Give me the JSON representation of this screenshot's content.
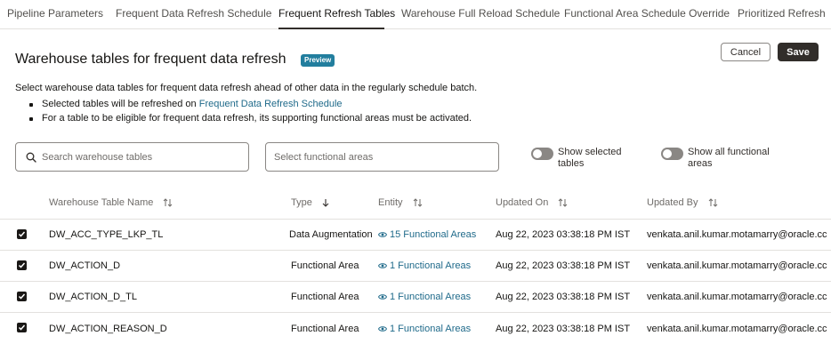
{
  "tabs": [
    {
      "label": "Pipeline Parameters"
    },
    {
      "label": "Frequent Data Refresh Schedule"
    },
    {
      "label": "Frequent Refresh Tables"
    },
    {
      "label": "Warehouse Full Reload Schedule"
    },
    {
      "label": "Functional Area Schedule Override"
    },
    {
      "label": "Prioritized Refresh"
    }
  ],
  "header": {
    "title": "Warehouse tables for frequent data refresh",
    "badge": "Preview",
    "cancel_label": "Cancel",
    "save_label": "Save"
  },
  "description": {
    "text": "Select warehouse data tables for frequent data refresh ahead of other data in the regularly schedule batch.",
    "bullet1_prefix": "Selected tables will be refreshed on ",
    "bullet1_link": "Frequent Data Refresh Schedule",
    "bullet2": "For a table to be eligible for frequent data refresh, its supporting functional areas must be activated."
  },
  "filters": {
    "search_placeholder": "Search warehouse tables",
    "functional_placeholder": "Select functional areas",
    "toggle_selected_label_1": "Show selected",
    "toggle_selected_label_2": "tables",
    "toggle_all_label_1": "Show all functional",
    "toggle_all_label_2": "areas"
  },
  "table": {
    "columns": [
      "Warehouse Table Name",
      "Type",
      "Entity",
      "Updated On",
      "Updated By"
    ],
    "rows": [
      {
        "name": "DW_ACC_TYPE_LKP_TL",
        "type": "Data Augmentation",
        "entity": "15 Functional Areas",
        "updated_on": "Aug 22, 2023 03:38:18 PM IST",
        "updated_by": "venkata.anil.kumar.motamarry@oracle.cc",
        "checked": true
      },
      {
        "name": "DW_ACTION_D",
        "type": "Functional Area",
        "entity": "1 Functional Areas",
        "updated_on": "Aug 22, 2023 03:38:18 PM IST",
        "updated_by": "venkata.anil.kumar.motamarry@oracle.cc",
        "checked": true
      },
      {
        "name": "DW_ACTION_D_TL",
        "type": "Functional Area",
        "entity": "1 Functional Areas",
        "updated_on": "Aug 22, 2023 03:38:18 PM IST",
        "updated_by": "venkata.anil.kumar.motamarry@oracle.cc",
        "checked": true
      },
      {
        "name": "DW_ACTION_REASON_D",
        "type": "Functional Area",
        "entity": "1 Functional Areas",
        "updated_on": "Aug 22, 2023 03:38:18 PM IST",
        "updated_by": "venkata.anil.kumar.motamarry@oracle.cc",
        "checked": true
      }
    ]
  },
  "colors": {
    "accent": "#227e9e",
    "link": "#1f6a8a",
    "primary_button": "#312d2a"
  }
}
